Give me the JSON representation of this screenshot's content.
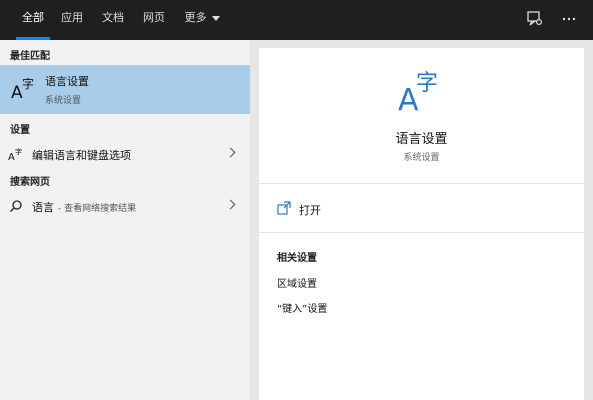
{
  "topbar": {
    "tabs": [
      "全部",
      "应用",
      "文档",
      "网页"
    ],
    "more_label": "更多"
  },
  "left": {
    "best_match_header": "最佳匹配",
    "best_match": {
      "title": "语言设置",
      "subtitle": "系统设置"
    },
    "settings_header": "设置",
    "settings_items": [
      "编辑语言和键盘选项"
    ],
    "web_header": "搜索网页",
    "web_item": {
      "title": "语言",
      "subtitle": "- 查看网络搜索结果"
    }
  },
  "right": {
    "title": "语言设置",
    "subtitle": "系统设置",
    "open_label": "打开",
    "related_header": "相关设置",
    "related_items": [
      "区域设置",
      "“键入”设置"
    ]
  },
  "icons": {
    "language": "language-icon",
    "search": "search-icon",
    "open": "open-icon",
    "feedback": "feedback-icon",
    "more": "more-options-icon"
  },
  "colors": {
    "accent": "#0a84ff",
    "selection": "#a9cde9",
    "icon_blue": "#2b79c9"
  }
}
